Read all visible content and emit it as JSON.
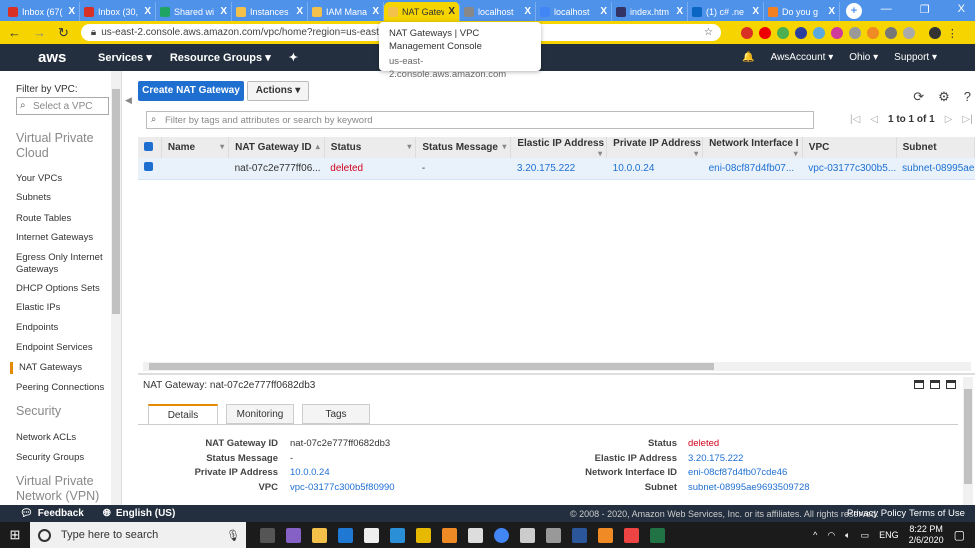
{
  "browser": {
    "tabs": [
      {
        "title": "Inbox (67(",
        "color": "#d93025"
      },
      {
        "title": "Inbox (30,",
        "color": "#d93025"
      },
      {
        "title": "Shared wi",
        "color": "#1fa463"
      },
      {
        "title": "Instances",
        "color": "#f3c04a"
      },
      {
        "title": "IAM Mana",
        "color": "#f3c04a"
      },
      {
        "title": "NAT Gatew",
        "color": "#f3c04a",
        "active": true
      },
      {
        "title": "localhost",
        "color": "#888888"
      },
      {
        "title": "localhost",
        "color": "#4285f4"
      },
      {
        "title": "index.htm",
        "color": "#333366"
      },
      {
        "title": "(1) c# .ne",
        "color": "#0a66c2"
      },
      {
        "title": "Do you g",
        "color": "#f48024"
      }
    ],
    "close_glyph": "X",
    "new_tab": "+",
    "window_controls": [
      "—",
      "❐",
      "X"
    ],
    "url": "us-east-2.console.aws.amazon.com/vpc/home?region=us-east-2#NatGate",
    "tooltip": {
      "title": "NAT Gateways | VPC Management Console",
      "url": "us-east-2.console.aws.amazon.com"
    }
  },
  "aws_nav": {
    "logo": "aws",
    "services": "Services ▾",
    "resource_groups": "Resource Groups ▾",
    "pin": "✦",
    "bell": "🔔",
    "account": "AwsAccount ▾",
    "region": "Ohio ▾",
    "support": "Support ▾"
  },
  "sidebar": {
    "filter_label": "Filter by VPC:",
    "vpc_placeholder": "Select a VPC",
    "heading_vpc": "Virtual Private Cloud",
    "items_vpc": [
      "Your VPCs",
      "Subnets",
      "Route Tables",
      "Internet Gateways",
      "Egress Only Internet Gateways",
      "DHCP Options Sets",
      "Elastic IPs",
      "Endpoints",
      "Endpoint Services",
      "NAT Gateways",
      "Peering Connections"
    ],
    "active": "NAT Gateways",
    "heading_security": "Security",
    "items_security": [
      "Network ACLs",
      "Security Groups"
    ],
    "heading_vpn": "Virtual Private Network (VPN)"
  },
  "toolbar": {
    "create": "Create NAT Gateway",
    "actions": "Actions ▾",
    "search_placeholder": "Filter by tags and attributes or search by keyword",
    "pager": "1 to 1 of 1"
  },
  "table": {
    "headers": [
      "Name",
      "NAT Gateway ID",
      "Status",
      "Status Message",
      "Elastic IP Address",
      "Private IP Address",
      "Network Interface I",
      "VPC",
      "Subnet"
    ],
    "rows": [
      {
        "name": "",
        "id": "nat-07c2e777ff06...",
        "status": "deleted",
        "message": "-",
        "eip": "3.20.175.222",
        "pip": "10.0.0.24",
        "eni": "eni-08cf87d4fb07...",
        "vpc": "vpc-03177c300b5...",
        "subnet": "subnet-08995ae"
      }
    ]
  },
  "detail": {
    "title_label": "NAT Gateway:",
    "title_value": "nat-07c2e777ff0682db3",
    "tabs": [
      "Details",
      "Monitoring",
      "Tags"
    ],
    "left": [
      {
        "k": "NAT Gateway ID",
        "v": "nat-07c2e777ff0682db3"
      },
      {
        "k": "Status Message",
        "v": "-"
      },
      {
        "k": "Private IP Address",
        "v": "10.0.0.24"
      },
      {
        "k": "VPC",
        "v": "vpc-03177c300b5f80990"
      }
    ],
    "right": [
      {
        "k": "Status",
        "v": "deleted"
      },
      {
        "k": "Elastic IP Address",
        "v": "3.20.175.222"
      },
      {
        "k": "Network Interface ID",
        "v": "eni-08cf87d4fb07cde46"
      },
      {
        "k": "Subnet",
        "v": "subnet-08995ae9693509728"
      }
    ]
  },
  "footer": {
    "feedback": "Feedback",
    "language": "English (US)",
    "copyright": "© 2008 - 2020, Amazon Web Services, Inc. or its affiliates. All rights reserved.",
    "privacy": "Privacy Policy",
    "terms": "Terms of Use"
  },
  "taskbar": {
    "search_placeholder": "Type here to search",
    "lang": "ENG",
    "time": "8:22 PM",
    "date": "2/6/2020"
  },
  "colors": {
    "accent": "#1f6fd1",
    "deleted": "#d0021b",
    "chrome_tab": "#f5d400",
    "aws_nav": "#232f3e"
  }
}
